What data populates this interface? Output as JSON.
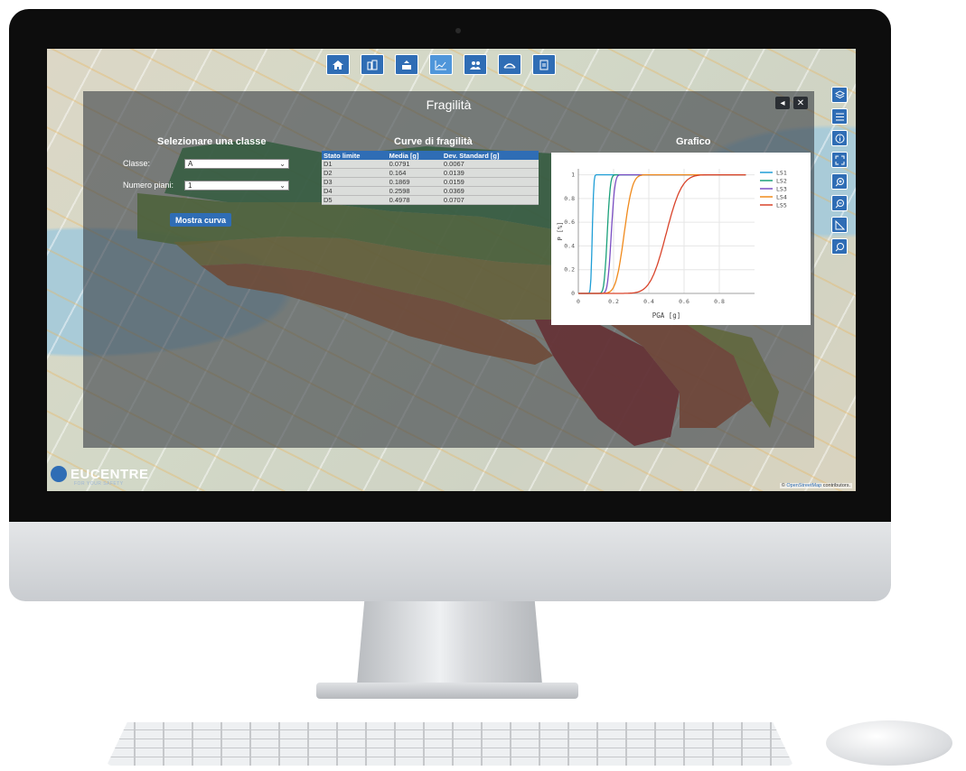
{
  "panel": {
    "title": "Fragilità",
    "back_label": "◂",
    "close_label": "✕"
  },
  "form": {
    "section_title": "Selezionare una classe",
    "classe_label": "Classe:",
    "classe_value": "A",
    "piani_label": "Numero piani:",
    "piani_value": "1",
    "button_label": "Mostra curva"
  },
  "table": {
    "section_title": "Curve di fragilità",
    "headers": [
      "Stato limite",
      "Media [g]",
      "Dev. Standard [g]"
    ],
    "rows": [
      [
        "D1",
        "0.0791",
        "0.0067"
      ],
      [
        "D2",
        "0.164",
        "0.0139"
      ],
      [
        "D3",
        "0.1869",
        "0.0159"
      ],
      [
        "D4",
        "0.2598",
        "0.0369"
      ],
      [
        "D5",
        "0.4978",
        "0.0707"
      ]
    ]
  },
  "graph": {
    "section_title": "Grafico"
  },
  "chart_data": {
    "type": "line",
    "xlabel": "PGA [g]",
    "ylabel": "P [%]",
    "xlim": [
      0,
      1
    ],
    "ylim": [
      0,
      1.05
    ],
    "xticks": [
      "0",
      "0.2",
      "0.4",
      "0.6",
      "0.8"
    ],
    "yticks": [
      "0",
      "0.2",
      "0.4",
      "0.6",
      "0.8",
      "1"
    ],
    "grid": true,
    "legend_position": "right",
    "series": [
      {
        "name": "LS1",
        "color": "#1f9ed6",
        "median": 0.0791,
        "std": 0.0067
      },
      {
        "name": "LS2",
        "color": "#1aa07a",
        "median": 0.164,
        "std": 0.0139
      },
      {
        "name": "LS3",
        "color": "#7b4fc4",
        "median": 0.1869,
        "std": 0.0159
      },
      {
        "name": "LS4",
        "color": "#f08a1c",
        "median": 0.2598,
        "std": 0.0369
      },
      {
        "name": "LS5",
        "color": "#d9442b",
        "median": 0.4978,
        "std": 0.0707
      }
    ]
  },
  "toolbar": {
    "icons": [
      "home-icon",
      "buildings-icon",
      "building-upload-icon",
      "chart-icon",
      "people-icon",
      "bridge-icon",
      "document-icon"
    ]
  },
  "side_tools": {
    "icons": [
      "layers-icon",
      "list-icon",
      "info-icon",
      "fullscreen-icon",
      "zoom-in-icon",
      "zoom-out-icon",
      "measure-icon",
      "search-icon"
    ]
  },
  "brand": {
    "name": "EUCENTRE",
    "tagline": "FOR YOUR SAFETY"
  },
  "attribution": {
    "prefix": "©",
    "link": "OpenStreetMap",
    "suffix": "contributors."
  },
  "colors": {
    "accent": "#2f6db5"
  }
}
